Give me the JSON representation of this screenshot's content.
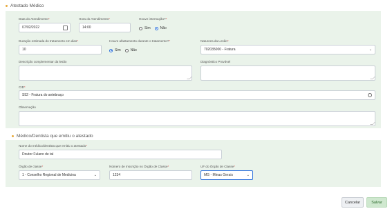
{
  "sections": {
    "atestado_title": "Atestado Médico",
    "medico_title": "Médico/Dentista que emitiu o atestado"
  },
  "fields": {
    "data_atendimento": {
      "label": "Data do Atendimento",
      "req": "*",
      "value": "07/02/2022"
    },
    "hora_atendimento": {
      "label": "Hora do Atendimento",
      "req": "*",
      "value": "14:00"
    },
    "internacao": {
      "label": "Houve internação?",
      "req": "*",
      "sim": "Sim",
      "nao": "Não"
    },
    "duracao": {
      "label": "Duração estimada do tratamento em dias",
      "req": "*",
      "value": "10"
    },
    "afastamento": {
      "label": "Houve afastamento durante o tratamento?",
      "req": "*",
      "sim": "Sim",
      "nao": "Não"
    },
    "natureza": {
      "label": "Natureza da Lesão",
      "req": "*",
      "value": "702035000 - Fratura"
    },
    "descricao": {
      "label": "Descrição complementar da lesão"
    },
    "diagnostico": {
      "label": "Diagnóstico Provável"
    },
    "cid": {
      "label": "CID",
      "req": "*",
      "value": "S52 - Fratura do antebraço"
    },
    "observacao": {
      "label": "Observação"
    },
    "nome_medico": {
      "label": "Nome do médico/dentista que emitiu o atestado",
      "req": "*",
      "value": "Doutor Fulano de tal"
    },
    "orgao_classe": {
      "label": "Órgão de classe",
      "req": "*",
      "value": "1 - Conselho Regional de Medicina"
    },
    "inscricao": {
      "label": "Número de Inscrição no Órgão de Classe",
      "req": "*",
      "value": "1234"
    },
    "uf_orgao": {
      "label": "UF do Órgão de Classe",
      "req": "*",
      "value": "MG - Minas Gerais"
    }
  },
  "buttons": {
    "cancelar": "Cancelar",
    "salvar": "Salvar"
  },
  "colors": {
    "panel_bg": "#eaf3ea",
    "accent_dot": "#e8a93a",
    "salvar_bg": "#cfe8cf",
    "focus_border": "#2a6fdb"
  }
}
